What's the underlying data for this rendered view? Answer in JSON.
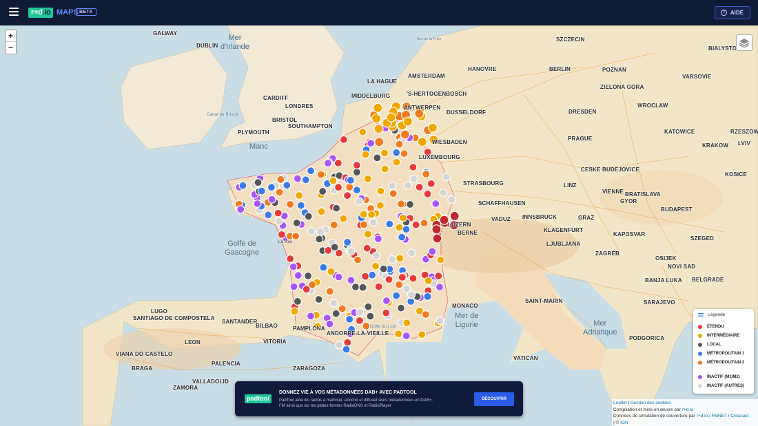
{
  "header": {
    "logo_main": "r+d",
    "logo_suffix": ".io",
    "product": "MAPS",
    "badge": "BETA",
    "help_label": "AIDE",
    "icons": [
      "menu-icon",
      "help-circle-icon"
    ]
  },
  "map": {
    "zoom_in": "+",
    "zoom_out": "−",
    "places": [
      {
        "id": "galway",
        "label": "GALWAY"
      },
      {
        "id": "dublin",
        "label": "DUBLIN"
      },
      {
        "id": "cardiff",
        "label": "CARDIFF"
      },
      {
        "id": "londres",
        "label": "LONDRES"
      },
      {
        "id": "middelburg",
        "label": "MIDDELBURG"
      },
      {
        "id": "la-haye",
        "label": "LA HAGUE"
      },
      {
        "id": "amsterdam",
        "label": "AMSTERDAM"
      },
      {
        "id": "hanovre",
        "label": "HANOVRE"
      },
      {
        "id": "berlin",
        "label": "BERLIN"
      },
      {
        "id": "poznan",
        "label": "POZNAN"
      },
      {
        "id": "varsovie",
        "label": "VARSOVIE"
      },
      {
        "id": "szczecin",
        "label": "SZCZECIN"
      },
      {
        "id": "bialystok",
        "label": "BIALYSTOK"
      },
      {
        "id": "s-hertogenbosch",
        "label": "'S-HERTOGENBOSCH"
      },
      {
        "id": "antwerpen",
        "label": "ANTWERPEN"
      },
      {
        "id": "dusseldorf",
        "label": "DUSSELDORF"
      },
      {
        "id": "wiesbaden",
        "label": "WIESBADEN"
      },
      {
        "id": "dresden",
        "label": "DRESDEN"
      },
      {
        "id": "wroclaw",
        "label": "WROCLAW"
      },
      {
        "id": "prague",
        "label": "PRAGUE"
      },
      {
        "id": "katowice",
        "label": "KATOWICE"
      },
      {
        "id": "krakow",
        "label": "KRAKOW"
      },
      {
        "id": "rzeszow",
        "label": "RZESZOW"
      },
      {
        "id": "lviv",
        "label": "LVIV"
      },
      {
        "id": "zielona-gora",
        "label": "ZIELONA GORA"
      },
      {
        "id": "ceske-budejovice",
        "label": "CESKE BUDEJOVICE"
      },
      {
        "id": "vienne",
        "label": "VIENNE"
      },
      {
        "id": "bratislava",
        "label": "BRATISLAVA"
      },
      {
        "id": "budapest",
        "label": "BUDAPEST"
      },
      {
        "id": "kosice",
        "label": "KOSICE"
      },
      {
        "id": "strasbourg",
        "label": "STRASBOURG"
      },
      {
        "id": "schaffhausen",
        "label": "SCHAFFHAUSEN"
      },
      {
        "id": "zurich",
        "label": "LUZERN"
      },
      {
        "id": "berne",
        "label": "BERNE"
      },
      {
        "id": "vaduz",
        "label": "VADUZ"
      },
      {
        "id": "innsbruck",
        "label": "INNSBRUCK"
      },
      {
        "id": "linz",
        "label": "LINZ"
      },
      {
        "id": "graz",
        "label": "GRAZ"
      },
      {
        "id": "klagenfurt",
        "label": "KLAGENFURT"
      },
      {
        "id": "ljubljana",
        "label": "LJUBLJANA"
      },
      {
        "id": "zagreb",
        "label": "ZAGREB"
      },
      {
        "id": "banja-luka",
        "label": "BANJA LUKA"
      },
      {
        "id": "belgrade",
        "label": "BELGRADE"
      },
      {
        "id": "novi-sad",
        "label": "NOVI SAD"
      },
      {
        "id": "sarajevo",
        "label": "SARAJEVO"
      },
      {
        "id": "podgorica",
        "label": "PODGORICA"
      },
      {
        "id": "monaco",
        "label": "MONACO"
      },
      {
        "id": "saint-marin",
        "label": "SAINT-MARIN"
      },
      {
        "id": "vatican",
        "label": "VATICAN"
      },
      {
        "id": "andorre",
        "label": "ANDORRE-LA-VIEILLE"
      },
      {
        "id": "pamplona",
        "label": "PAMPLONA"
      },
      {
        "id": "leon",
        "label": "LEON"
      },
      {
        "id": "santander",
        "label": "SANTANDER"
      },
      {
        "id": "bilbao",
        "label": "BILBAO"
      },
      {
        "id": "vitoria",
        "label": "VITORIA"
      },
      {
        "id": "zaragoza",
        "label": "ZARAGOZA"
      },
      {
        "id": "valladolid",
        "label": "VALLADOLID"
      },
      {
        "id": "viana",
        "label": "VIANA DO CASTELO"
      },
      {
        "id": "braga",
        "label": "BRAGA"
      },
      {
        "id": "zamora",
        "label": "ZAMORA"
      },
      {
        "id": "santiago",
        "label": "SANTIAGO DE COMPOSTELA"
      },
      {
        "id": "lugo",
        "label": "LUGO"
      },
      {
        "id": "palencia",
        "label": "PALENCIA"
      },
      {
        "id": "bristol",
        "label": "BRISTOL"
      },
      {
        "id": "southampton",
        "label": "SOUTHAMPTON"
      },
      {
        "id": "plymouth",
        "label": "PLYMOUTH"
      },
      {
        "id": "luxembourg",
        "label": "LUXEMBOURG"
      },
      {
        "id": "kaposvar",
        "label": "KAPOSVAR"
      },
      {
        "id": "osijek",
        "label": "OSIJEK"
      },
      {
        "id": "szeged",
        "label": "SZEGED"
      },
      {
        "id": "gyor",
        "label": "GYOR"
      },
      {
        "id": "lisbonne",
        "label": "ZAMORA"
      }
    ],
    "seas": [
      {
        "id": "mer-irlande",
        "label_1": "Mer",
        "label_2": "d'Irlande"
      },
      {
        "id": "golfe-gascogne",
        "label_1": "Golfe de",
        "label_2": "Gascogne"
      },
      {
        "id": "mer-ligurie",
        "label_1": "Mer de",
        "label_2": "Ligurie"
      },
      {
        "id": "mer-adriatique",
        "label_1": "Mer",
        "label_2": "Adriatique"
      },
      {
        "id": "manche",
        "label_1": "Manc",
        "label_2": ""
      }
    ],
    "small_labels": {
      "canal_bristol": "Canal de Bristol",
      "golfe_lion": "Golfe du Lion",
      "la_rochelle": "La Roc",
      "mer_frise": "Iles de la Frise"
    },
    "marker_colors": {
      "etendu": "#e63b3b",
      "intermediaire": "#f0a800",
      "local": "#555555",
      "metropolitain_1": "#3a7be8",
      "metropolitain_2": "#f07a1e",
      "inactif_m": "#a855f7",
      "inactif_autres": "#d5d5d5"
    }
  },
  "legend": {
    "title": "Légende",
    "items": [
      {
        "label": "ÉTENDU",
        "color": "#e63b3b"
      },
      {
        "label": "INTERMÉDIAIRE",
        "color": "#f0a800"
      },
      {
        "label": "LOCAL",
        "color": "#555555"
      },
      {
        "label": "MÉTROPOLITAIN 1",
        "color": "#3a7be8"
      },
      {
        "label": "MÉTROPOLITAIN 2",
        "color": "#f07a1e"
      },
      {
        "label": "INACTIF (M1/M2)",
        "color": "#a855f7"
      },
      {
        "label": "INACTIF (AUTRES)",
        "color": "#d5d5d5"
      }
    ]
  },
  "promo": {
    "logo": "padtool",
    "title": "DONNEZ VIE À VOS MÉTADONNÉES DAB+ AVEC PADTOOL",
    "text": "PadTool aide les radios à maîtriser, enrichir et diffuser leurs métadonnées en DAB+, FM ainsi que sur les plates-formes RadioDNS et RadioPlayer",
    "button": "DÉCOUVRIR"
  },
  "attribution": {
    "leaflet": "Leaflet",
    "sep": " | ",
    "gestion": "Gestion des cookies",
    "line2_pre": "Compilation et mise en œuvre par ",
    "line2_link": "r+d.io",
    "line3_pre": "Données de simulation de couverture par ",
    "line3_link1": "r+d.io",
    "line3_sep": " / ",
    "line3_link2": "FMNET",
    "line3_link3": "Creacast",
    "line4_pre": " | © ",
    "line4_link": "IGN"
  }
}
